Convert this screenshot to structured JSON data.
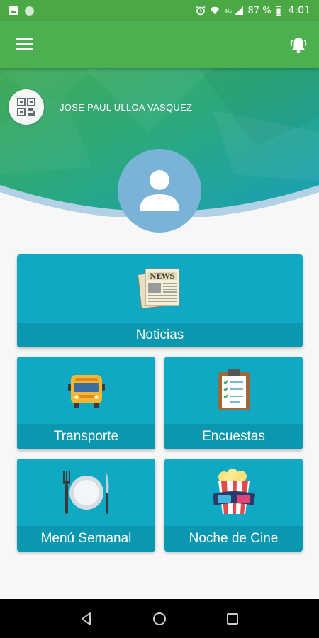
{
  "status_bar": {
    "network": "4G",
    "battery": "87 %",
    "time": "4:01"
  },
  "profile": {
    "name": "JOSE PAUL ULLOA VASQUEZ"
  },
  "menu": {
    "noticias": "Noticias",
    "transporte": "Transporte",
    "encuestas": "Encuestas",
    "menu_semanal": "Menú Semanal",
    "noche_de_cine": "Noche de Cine"
  },
  "icons": {
    "news_badge": "NEWS"
  },
  "colors": {
    "toolbar": "#4caf50",
    "card": "#0fa9c3",
    "card_label": "#0a97b0",
    "avatar": "#7bb3d6"
  }
}
